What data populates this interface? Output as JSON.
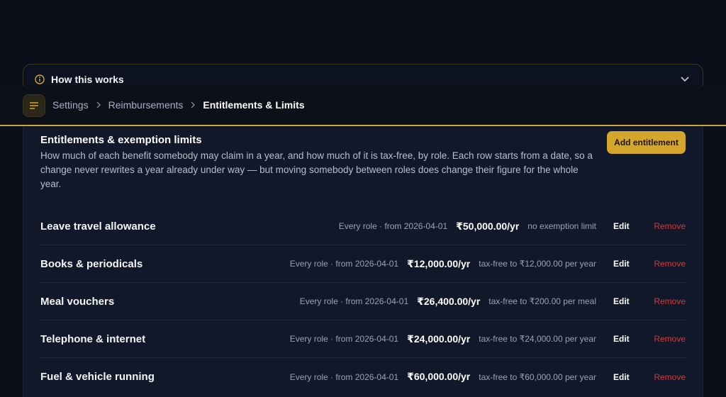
{
  "how": {
    "title": "How this works"
  },
  "breadcrumb": [
    "Settings",
    "Reimbursements",
    "Entitlements & Limits"
  ],
  "panel": {
    "title": "Entitlements & exemption limits",
    "description": "How much of each benefit somebody may claim in a year, and how much of it is tax-free, by role. Each row starts from a date, so a change never rewrites a year already under way — but moving somebody between roles does change their figure for the whole year.",
    "add_label": "Add entitlement"
  },
  "rows": [
    {
      "name": "Leave travel allowance",
      "meta": "Every role · from 2026-04-01",
      "amount": "₹50,000.00/yr",
      "limit": "no exemption limit",
      "edit": "Edit",
      "remove": "Remove"
    },
    {
      "name": "Books & periodicals",
      "meta": "Every role · from 2026-04-01",
      "amount": "₹12,000.00/yr",
      "limit": "tax-free to ₹12,000.00 per year",
      "edit": "Edit",
      "remove": "Remove"
    },
    {
      "name": "Meal vouchers",
      "meta": "Every role · from 2026-04-01",
      "amount": "₹26,400.00/yr",
      "limit": "tax-free to ₹200.00 per meal",
      "edit": "Edit",
      "remove": "Remove"
    },
    {
      "name": "Telephone & internet",
      "meta": "Every role · from 2026-04-01",
      "amount": "₹24,000.00/yr",
      "limit": "tax-free to ₹24,000.00 per year",
      "edit": "Edit",
      "remove": "Remove"
    },
    {
      "name": "Fuel & vehicle running",
      "meta": "Every role · from 2026-04-01",
      "amount": "₹60,000.00/yr",
      "limit": "tax-free to ₹60,000.00 per year",
      "edit": "Edit",
      "remove": "Remove"
    }
  ],
  "colors": {
    "accent": "#d4a72c",
    "remove": "#d23a3a",
    "background": "#0a0f1a"
  }
}
